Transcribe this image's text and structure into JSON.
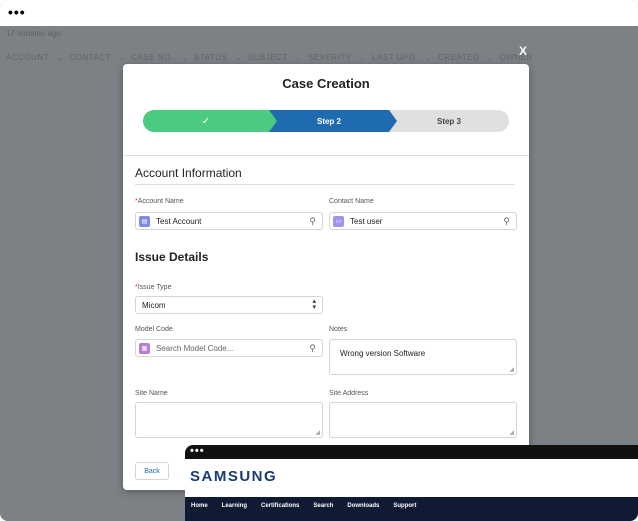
{
  "background_app": {
    "subtext": "17 minutes ago",
    "columns": [
      "ACCOUNT",
      "CONTACT",
      "CASE NO.",
      "STATUS",
      "SUBJECT",
      "SEVERITY",
      "LAST UPD.",
      "CREATED",
      "OWNER"
    ],
    "close_label": "X"
  },
  "modal": {
    "title": "Case Creation",
    "steps": [
      {
        "label": "✓",
        "state": "complete"
      },
      {
        "label": "Step 2",
        "state": "active"
      },
      {
        "label": "Step 3",
        "state": "upcoming"
      }
    ],
    "account_section": "Account Information",
    "issue_section": "Issue Details",
    "fields": {
      "account_name": {
        "label": "Account Name",
        "required": true,
        "value": "Test Account",
        "icon": "account-icon"
      },
      "contact_name": {
        "label": "Contact Name",
        "required": false,
        "value": "Test user",
        "icon": "contact-icon"
      },
      "issue_type": {
        "label": "Issue Type",
        "required": true,
        "value": "Micom"
      },
      "model_code": {
        "label": "Model Code",
        "placeholder": "Search Model Code...",
        "icon": "product-icon"
      },
      "notes": {
        "label": "Notes",
        "value": "Wrong version Software"
      },
      "site_name": {
        "label": "Site Name",
        "value": ""
      },
      "site_address": {
        "label": "Site Address",
        "value": ""
      }
    },
    "back_label": "Back"
  },
  "colors": {
    "step_complete": "#4bca81",
    "step_active": "#1f6bb0",
    "step_upcoming": "#e0e0e0",
    "required": "#c23934"
  },
  "samsung": {
    "logo": "SAMSUNG",
    "nav": [
      "Home",
      "Learning",
      "Certifications",
      "Search",
      "Downloads",
      "Support"
    ]
  }
}
